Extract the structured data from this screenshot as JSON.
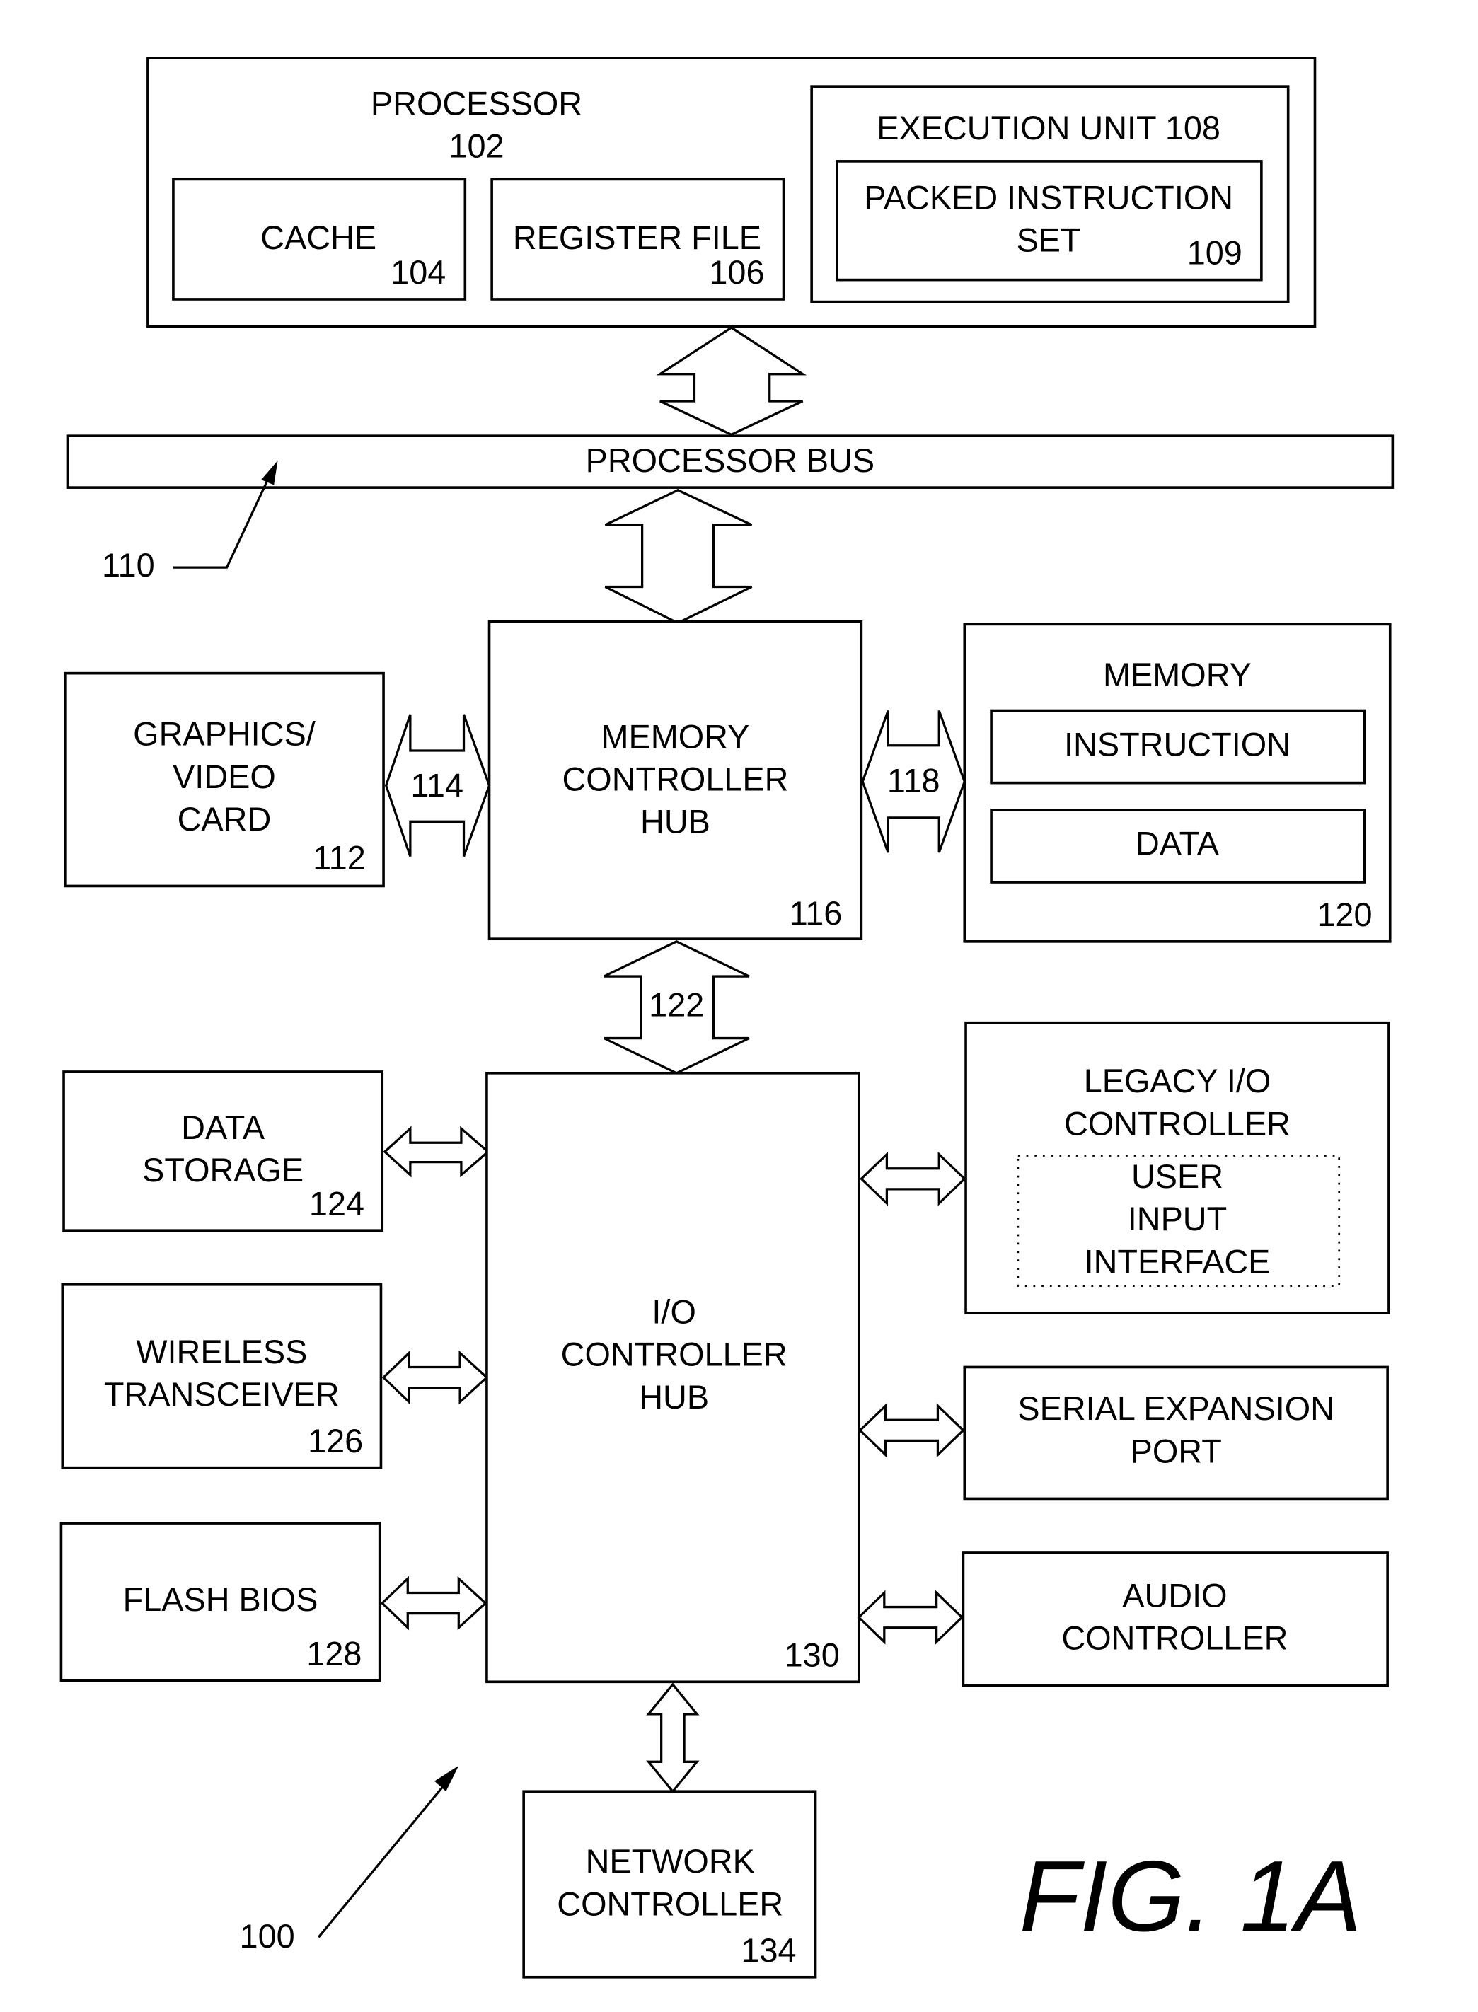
{
  "figure_label": "FIG. 1A",
  "system_ref": "100",
  "processor": {
    "title": "PROCESSOR",
    "ref": "102",
    "cache": {
      "label": "CACHE",
      "ref": "104"
    },
    "register_file": {
      "label": "REGISTER FILE",
      "ref": "106"
    },
    "execution_unit": {
      "label": "EXECUTION UNIT 108"
    },
    "packed_instruction_set": {
      "line1": "PACKED INSTRUCTION",
      "line2": "SET",
      "ref": "109"
    }
  },
  "processor_bus": {
    "label": "PROCESSOR BUS",
    "ref": "110"
  },
  "graphics_card": {
    "line1": "GRAPHICS/",
    "line2": "VIDEO",
    "line3": "CARD",
    "ref": "112",
    "link_ref": "114"
  },
  "memory_controller_hub": {
    "line1": "MEMORY",
    "line2": "CONTROLLER",
    "line3": "HUB",
    "ref": "116"
  },
  "memory": {
    "title": "MEMORY",
    "instruction": "INSTRUCTION",
    "data": "DATA",
    "ref": "120",
    "link_ref": "118"
  },
  "hub_link_ref": "122",
  "data_storage": {
    "line1": "DATA",
    "line2": "STORAGE",
    "ref": "124"
  },
  "wireless_transceiver": {
    "line1": "WIRELESS",
    "line2": "TRANSCEIVER",
    "ref": "126"
  },
  "flash_bios": {
    "label": "FLASH BIOS",
    "ref": "128"
  },
  "io_controller_hub": {
    "line1": "I/O",
    "line2": "CONTROLLER",
    "line3": "HUB",
    "ref": "130"
  },
  "legacy_io": {
    "line1": "LEGACY I/O",
    "line2": "CONTROLLER",
    "user_input": [
      "USER",
      "INPUT",
      "INTERFACE"
    ]
  },
  "serial_expansion": {
    "line1": "SERIAL EXPANSION",
    "line2": "PORT"
  },
  "audio_controller": {
    "line1": "AUDIO",
    "line2": "CONTROLLER"
  },
  "network_controller": {
    "line1": "NETWORK",
    "line2": "CONTROLLER",
    "ref": "134"
  }
}
